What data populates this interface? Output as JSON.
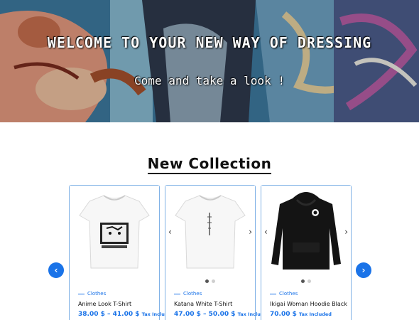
{
  "hero": {
    "title": "WELCOME TO YOUR NEW WAY OF DRESSING",
    "subtitle": "Come and take a look !"
  },
  "section": {
    "title": "New Collection"
  },
  "carousel": {
    "prev_icon": "chevron-left-icon",
    "next_icon": "chevron-right-icon"
  },
  "products": [
    {
      "category": "Clothes",
      "name": "Anime Look T-Shirt",
      "price": "38.00 $ – 41.00 $",
      "tax": "Tax Included",
      "dots": 0
    },
    {
      "category": "Clothes",
      "name": "Katana White T-Shirt",
      "price": "47.00 $ – 50.00 $",
      "tax": "Tax Included",
      "dots": 2
    },
    {
      "category": "Clothes",
      "name": "Ikigai Woman Hoodie Black",
      "price": "70.00 $",
      "tax": "Tax Included",
      "dots": 2
    }
  ],
  "colors": {
    "accent": "#1a73e8",
    "card_border": "#7fb1e6"
  }
}
